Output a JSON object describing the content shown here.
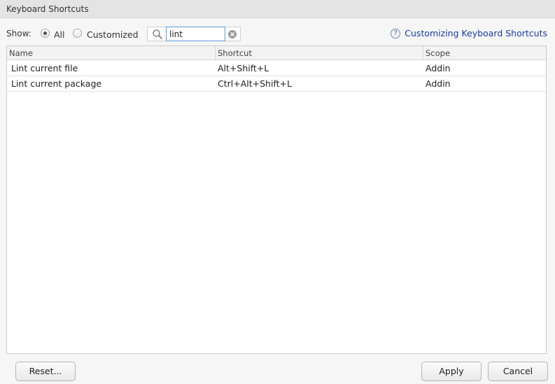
{
  "window": {
    "title": "Keyboard Shortcuts"
  },
  "toolbar": {
    "show_label": "Show:",
    "filter_options": [
      {
        "label": "All",
        "selected": true
      },
      {
        "label": "Customized",
        "selected": false
      }
    ],
    "search": {
      "value": "lint",
      "icon": "search-icon",
      "clear_icon": "clear-search-icon"
    },
    "help_link": {
      "label": "Customizing Keyboard Shortcuts",
      "icon": "help-icon",
      "icon_glyph": "?"
    }
  },
  "table": {
    "columns": [
      "Name",
      "Shortcut",
      "Scope"
    ],
    "rows": [
      {
        "name": "Lint current file",
        "shortcut": "Alt+Shift+L",
        "scope": "Addin"
      },
      {
        "name": "Lint current package",
        "shortcut": "Ctrl+Alt+Shift+L",
        "scope": "Addin"
      }
    ]
  },
  "buttons": {
    "reset": "Reset...",
    "apply": "Apply",
    "cancel": "Cancel"
  },
  "colors": {
    "link": "#1a3c9c",
    "focus_border": "#5b9bd5"
  }
}
